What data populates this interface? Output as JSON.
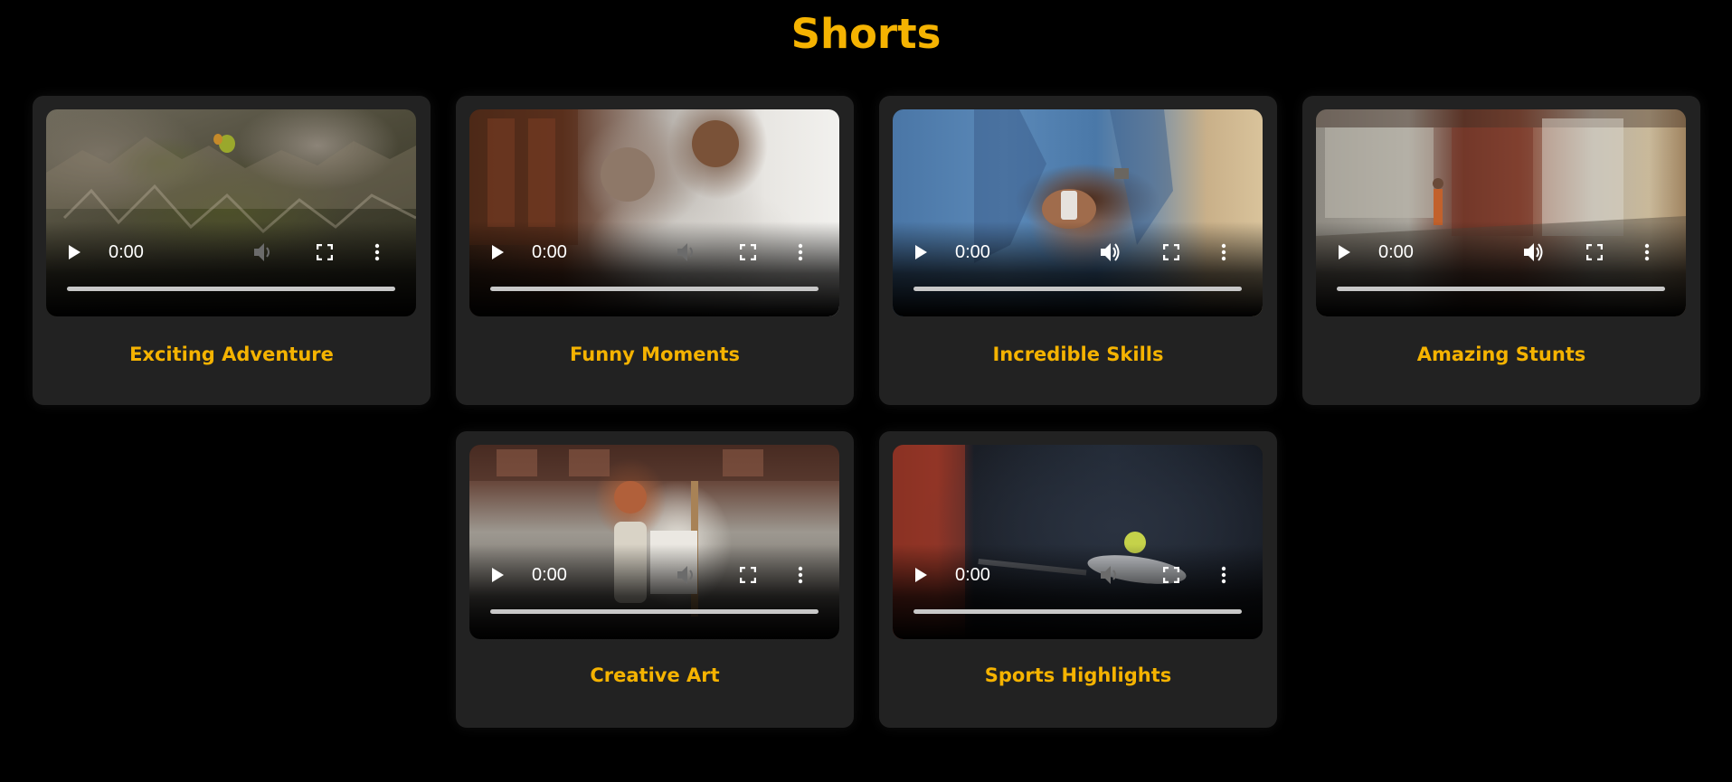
{
  "page": {
    "title": "Shorts",
    "accent_color": "#f5b301",
    "background_color": "#000000",
    "card_color": "#222222"
  },
  "videos": [
    {
      "title": "Exciting Adventure",
      "time": "0:00",
      "volume_icon": "volume-muted-icon",
      "scene": "aerial rocky valley with hot air balloons"
    },
    {
      "title": "Funny Moments",
      "time": "0:00",
      "volume_icon": "volume-muted-icon",
      "scene": "father and daughter laughing"
    },
    {
      "title": "Incredible Skills",
      "time": "0:00",
      "volume_icon": "volume-icon",
      "scene": "hands shuffling cards"
    },
    {
      "title": "Amazing Stunts",
      "time": "0:00",
      "volume_icon": "volume-icon",
      "scene": "skater on stairs by brick building"
    },
    {
      "title": "Creative Art",
      "time": "0:00",
      "volume_icon": "volume-muted-icon",
      "scene": "woman painting at easel"
    },
    {
      "title": "Sports Highlights",
      "time": "0:00",
      "volume_icon": "volume-muted-icon",
      "scene": "tennis racket and ball"
    }
  ]
}
